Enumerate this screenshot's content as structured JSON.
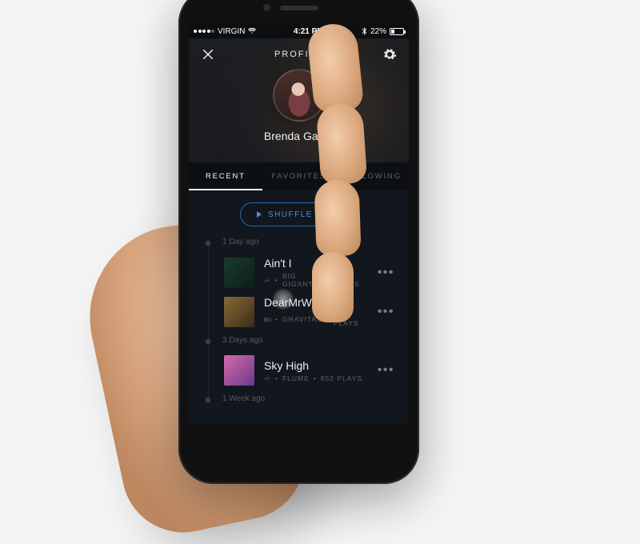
{
  "statusbar": {
    "carrier": "VIRGIN",
    "time": "4:21 PM",
    "battery_pct": "22%"
  },
  "header": {
    "title": "PROFILE",
    "user_name": "Brenda Garza"
  },
  "tabs": {
    "items": [
      {
        "label": "RECENT",
        "active": true
      },
      {
        "label": "FAVORITES",
        "active": false
      },
      {
        "label": "FOLLOWING",
        "active": false
      }
    ]
  },
  "shuffle": {
    "label": "SHUFFLE PLAY"
  },
  "timeline": [
    {
      "label": "1 Day ago",
      "tracks": [
        {
          "title": "Ain't I",
          "artist": "BIG GIGANTIC",
          "plays": "852 PLAYS",
          "type": "audio"
        },
        {
          "title": "DearMrWatterson",
          "artist": "GRAVITAS",
          "plays": "852 PLAYS",
          "type": "video"
        }
      ]
    },
    {
      "label": "3 Days ago",
      "tracks": [
        {
          "title": "Sky High",
          "artist": "FLUME",
          "plays": "852 PLAYS",
          "type": "audio"
        }
      ]
    },
    {
      "label": "1 Week ago",
      "tracks": []
    }
  ]
}
